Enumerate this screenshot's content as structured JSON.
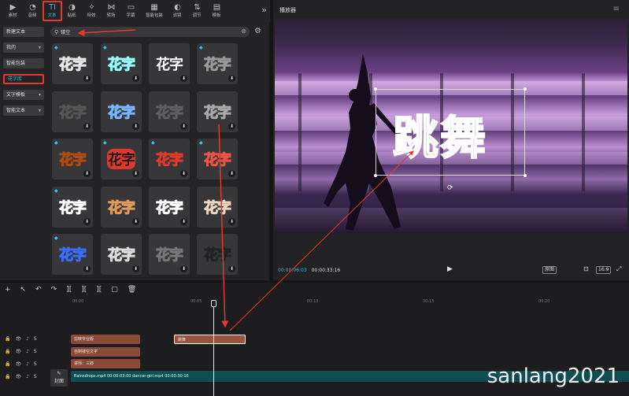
{
  "toolbar": {
    "tabs": [
      {
        "icon": "▶",
        "label": "素材"
      },
      {
        "icon": "◔",
        "label": "音频"
      },
      {
        "icon": "TI",
        "label": "文本"
      },
      {
        "icon": "◑",
        "label": "贴纸"
      },
      {
        "icon": "✧",
        "label": "特效"
      },
      {
        "icon": "⋈",
        "label": "转场"
      },
      {
        "icon": "▭",
        "label": "字幕"
      },
      {
        "icon": "▦",
        "label": "智能包装"
      },
      {
        "icon": "◐",
        "label": "滤镜"
      },
      {
        "icon": "⇅",
        "label": "调节"
      },
      {
        "icon": "▤",
        "label": "模板"
      }
    ],
    "more": "»"
  },
  "sidebar": {
    "items": [
      {
        "label": "新建文本",
        "dropdown": ""
      },
      {
        "label": "我的",
        "dropdown": "▾"
      },
      {
        "label": "智能包装",
        "dropdown": ""
      },
      {
        "label": "花字库",
        "dropdown": ""
      },
      {
        "label": "文字模板",
        "dropdown": "▾"
      },
      {
        "label": "智能文本",
        "dropdown": "▾"
      }
    ]
  },
  "search": {
    "value": "镂空",
    "clear": "⊗",
    "icon": "⚲"
  },
  "tiles": {
    "text": "花字",
    "gem": "◆",
    "download": "⬇"
  },
  "player": {
    "title": "播放器",
    "menu": "≡",
    "overlay_text": "跳舞",
    "time_current": "00:00:06:03",
    "time_total": "00:00:33:16",
    "play": "▶",
    "ctrl_original": "原图",
    "ctrl_fit": "⊡",
    "ctrl_ratio": "16:9",
    "ctrl_full": "⤢"
  },
  "timeline": {
    "tools": [
      "+",
      "↖",
      "↶",
      "↷",
      "][",
      "][",
      "][",
      "▢",
      "🗑"
    ],
    "ruler": [
      "00:00",
      "00:05",
      "00:10",
      "00:15",
      "00:20"
    ],
    "track_icons": "🔒👁♪S",
    "clips": [
      {
        "label": "剪映专业版"
      },
      {
        "label": "跳舞"
      },
      {
        "label": "自制镂空文字"
      },
      {
        "label": "讲师：三郎"
      }
    ],
    "video_clip": "Rainsdrops.mp4   00:00:03:00      dancer-girl.mp4   00:00:30:16",
    "cover": "封面"
  },
  "watermark": "sanlang2021"
}
